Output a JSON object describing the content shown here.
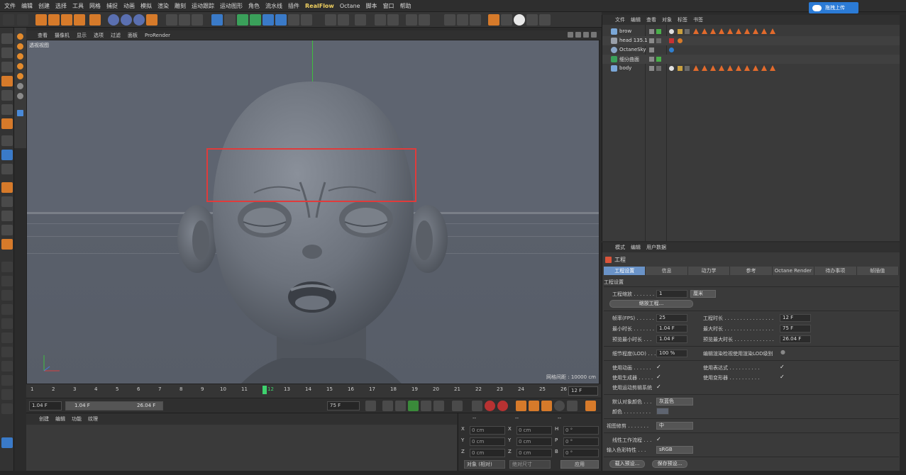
{
  "menu": [
    "文件",
    "编辑",
    "创建",
    "选择",
    "工具",
    "网格",
    "捕捉",
    "动画",
    "模拟",
    "渲染",
    "雕刻",
    "运动跟踪",
    "运动图形",
    "角色",
    "流水线",
    "插件",
    "RealFlow",
    "Octane",
    "脚本",
    "窗口",
    "帮助"
  ],
  "upload_label": "拖拽上传",
  "viewport": {
    "menu": [
      "查看",
      "摄像机",
      "显示",
      "选项",
      "过滤",
      "面板",
      "ProRender"
    ],
    "label": "透视视图",
    "grid_info": "网格间距 : 10000 cm"
  },
  "timeline": {
    "ticks": [
      "1",
      "2",
      "3",
      "4",
      "5",
      "6",
      "7",
      "8",
      "9",
      "10",
      "11",
      "12",
      "13",
      "14",
      "15",
      "16",
      "17",
      "18",
      "19",
      "20",
      "21",
      "22",
      "23",
      "24",
      "25",
      "26"
    ],
    "current": "12",
    "end_frame": "12 F"
  },
  "transport": {
    "start": "1.04 F",
    "range_start": "1.04 F",
    "range_end": "26.04 F",
    "end": "75 F"
  },
  "material_panel": {
    "menu": [
      "创建",
      "编辑",
      "功能",
      "纹理"
    ]
  },
  "coords": {
    "headers": [
      "--",
      "--",
      "--"
    ],
    "rows": [
      {
        "a": "X",
        "av": "0 cm",
        "b": "X",
        "bv": "0 cm",
        "c": "H",
        "cv": "0 °"
      },
      {
        "a": "Y",
        "av": "0 cm",
        "b": "Y",
        "bv": "0 cm",
        "c": "P",
        "cv": "0 °"
      },
      {
        "a": "Z",
        "av": "0 cm",
        "b": "Z",
        "bv": "0 cm",
        "c": "B",
        "cv": "0 °"
      }
    ],
    "mode": "对象 (相对)",
    "size_mode": "绝对尺寸",
    "apply": "应用"
  },
  "object_manager": {
    "menu": [
      "文件",
      "编辑",
      "查看",
      "对象",
      "标签",
      "书签"
    ],
    "objects": [
      {
        "name": "brow"
      },
      {
        "name": "head 135.1"
      },
      {
        "name": "OctaneSky"
      },
      {
        "name": "细分曲面"
      },
      {
        "name": "body"
      }
    ]
  },
  "attributes": {
    "menu": [
      "模式",
      "编辑",
      "用户数据"
    ],
    "title": "工程",
    "tabs": [
      "工程设置",
      "信息",
      "动力学",
      "参考",
      "Octane Render",
      "待办事项",
      "帧插值"
    ],
    "section": "工程设置",
    "project_scale_label": "工程缩放 . . . . . . .",
    "project_scale_value": "1",
    "project_scale_unit": "厘米",
    "scale_button": "缩放工程...",
    "fps_label": "帧率(FPS) . . . . . .",
    "fps_value": "25",
    "project_length_label": "工程时长 . . . . . . . . . . . . . . . .",
    "project_length_value": "12 F",
    "min_time_label": "最小时长 . . . . . . .",
    "min_time_value": "1.04 F",
    "max_time_label": "最大时长 . . . . . . . . . . . . . . . .",
    "max_time_value": "75 F",
    "preview_min_label": "预览最小时长 . . .",
    "preview_min_value": "1.04 F",
    "preview_max_label": "预览最大时长 . . . . . . . . . . . . .",
    "preview_max_value": "26.04 F",
    "lod_label": "细节程度(LOD) . . .",
    "lod_value": "100 %",
    "render_lod_label": "编辑渲染检视使用渲染LOD级别",
    "use_anim_label": "使用动画 . . . . . .",
    "use_expr_label": "使用表达式 . . . . . . . . . .",
    "use_gen_label": "使用生成器 . . . . .",
    "use_deform_label": "使用变形器 . . . . . . . . . .",
    "use_motion_label": "使用运动剪辑系统",
    "default_color_label": "默认对象颜色 . . .",
    "default_color_value": "灰蓝色",
    "color_label": "颜色 . . . . . . . . .",
    "view_clip_label": "视图修剪 . . . . . . .",
    "view_clip_value": "中",
    "linear_label": "线性工作流程 . . .",
    "input_color_label": "输入色彩特性 . . .",
    "input_color_value": "sRGB",
    "load_preset": "载入预设...",
    "save_preset": "保存预设..."
  }
}
